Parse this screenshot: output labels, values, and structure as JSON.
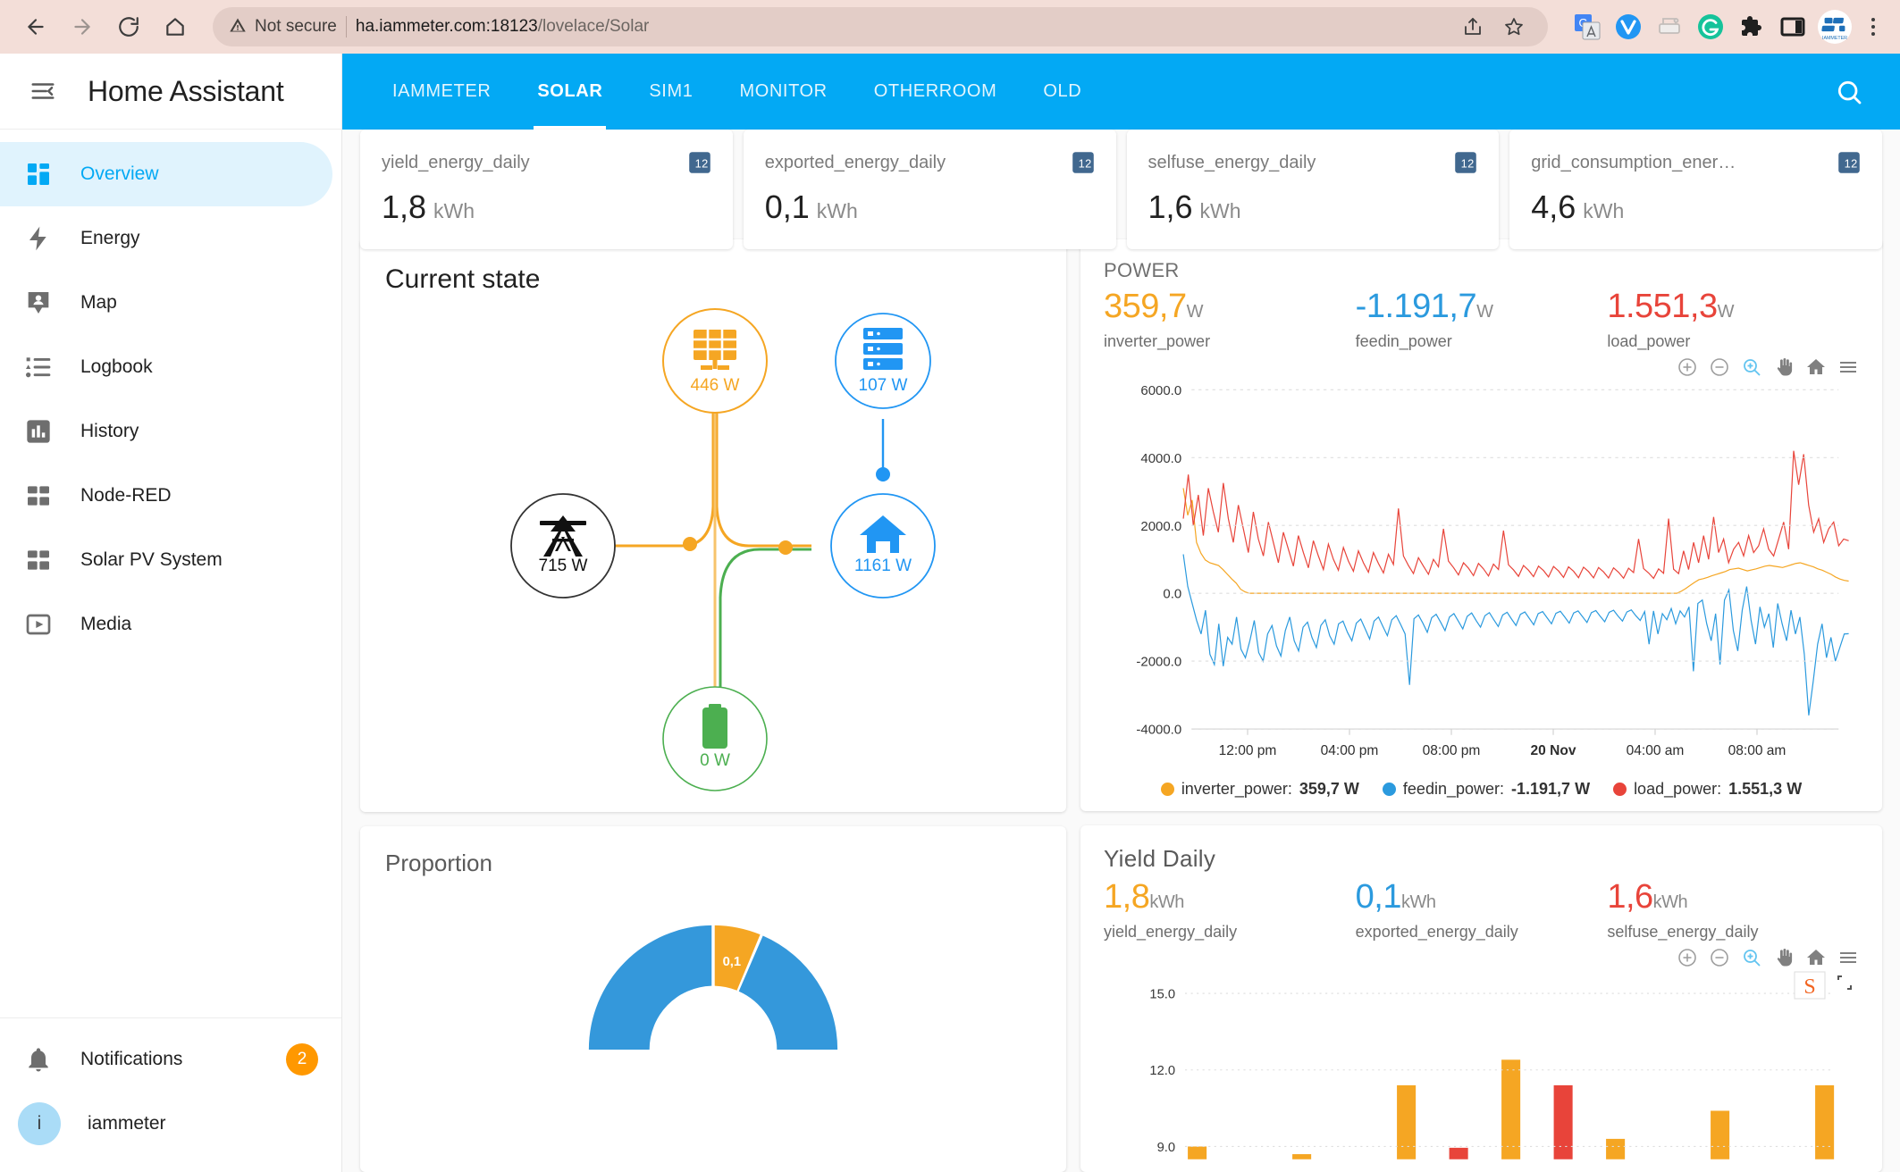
{
  "browser": {
    "security_label": "Not secure",
    "url_host": "ha.iammeter.com:18123",
    "url_path": "/lovelace/Solar",
    "icons": [
      "back-icon",
      "forward-icon",
      "reload-icon",
      "home-icon",
      "warning-icon",
      "share-icon",
      "bookmark-star-icon",
      "google-translate-icon",
      "vimium-icon",
      "print-icon",
      "grammarly-icon",
      "extensions-puzzle-icon",
      "side-panel-icon",
      "profile-avatar-icon",
      "browser-menu-icon"
    ]
  },
  "sidebar": {
    "title": "Home Assistant",
    "items": [
      {
        "label": "Overview",
        "icon": "view-dashboard-icon",
        "active": true
      },
      {
        "label": "Energy",
        "icon": "lightning-bolt-icon",
        "active": false
      },
      {
        "label": "Map",
        "icon": "map-marker-account-icon",
        "active": false
      },
      {
        "label": "Logbook",
        "icon": "format-list-icon",
        "active": false
      },
      {
        "label": "History",
        "icon": "chart-box-icon",
        "active": false
      },
      {
        "label": "Node-RED",
        "icon": "view-dashboard-icon",
        "active": false
      },
      {
        "label": "Solar PV System",
        "icon": "view-dashboard-icon",
        "active": false
      },
      {
        "label": "Media",
        "icon": "play-box-icon",
        "active": false
      }
    ],
    "notifications": {
      "label": "Notifications",
      "count": "2",
      "icon": "bell-icon"
    },
    "user": {
      "label": "iammeter",
      "initial": "i"
    }
  },
  "topbar": {
    "tabs": [
      {
        "label": "IAMMETER",
        "active": false
      },
      {
        "label": "SOLAR",
        "active": true
      },
      {
        "label": "SIM1",
        "active": false
      },
      {
        "label": "MONITOR",
        "active": false
      },
      {
        "label": "OTHERROOM",
        "active": false
      },
      {
        "label": "OLD",
        "active": false
      }
    ],
    "search_icon": "search-icon"
  },
  "stat_cards": [
    {
      "name": "yield_energy_daily",
      "value": "1,8",
      "unit": "kWh",
      "icon": "numeric-badge-icon"
    },
    {
      "name": "exported_energy_daily",
      "value": "0,1",
      "unit": "kWh",
      "icon": "numeric-badge-icon"
    },
    {
      "name": "selfuse_energy_daily",
      "value": "1,6",
      "unit": "kWh",
      "icon": "numeric-badge-icon"
    },
    {
      "name": "grid_consumption_ener…",
      "value": "4,6",
      "unit": "kWh",
      "icon": "numeric-badge-icon"
    }
  ],
  "current_state": {
    "title": "Current state",
    "nodes": {
      "solar": {
        "value": "446 W",
        "icon": "solar-panel-icon",
        "color": "#f5a623"
      },
      "grid": {
        "value": "715 W",
        "icon": "transmission-tower-icon",
        "color": "#212121"
      },
      "home": {
        "value": "1161 W",
        "icon": "home-icon",
        "color": "#2196f3"
      },
      "server": {
        "value": "107 W",
        "icon": "server-rack-icon",
        "color": "#2196f3"
      },
      "battery": {
        "value": "0 W",
        "icon": "battery-icon",
        "color": "#4caf50"
      }
    }
  },
  "proportion": {
    "title": "Proportion",
    "slice_label": "0,1"
  },
  "power_card": {
    "title": "POWER",
    "stats": [
      {
        "value": "359,7",
        "unit": "W",
        "name": "inverter_power",
        "color": "#f5a623"
      },
      {
        "value": "-1.191,7",
        "unit": "W",
        "name": "feedin_power",
        "color": "#2b9ade"
      },
      {
        "value": "1.551,3",
        "unit": "W",
        "name": "load_power",
        "color": "#e8443a"
      }
    ],
    "tools": [
      "zoom-in-icon",
      "zoom-out-icon",
      "selection-zoom-icon",
      "pan-hand-icon",
      "reset-home-icon",
      "menu-icon"
    ],
    "legend": [
      {
        "label": "inverter_power:",
        "value": "359,7 W",
        "color": "#f5a623"
      },
      {
        "label": "feedin_power:",
        "value": "-1.191,7 W",
        "color": "#2b9ade"
      },
      {
        "label": "load_power:",
        "value": "1.551,3 W",
        "color": "#e8443a"
      }
    ]
  },
  "yield_card": {
    "title": "Yield Daily",
    "stats": [
      {
        "value": "1,8",
        "unit": "kWh",
        "name": "yield_energy_daily",
        "color": "#f5a623"
      },
      {
        "value": "0,1",
        "unit": "kWh",
        "name": "exported_energy_daily",
        "color": "#2b9ade"
      },
      {
        "value": "1,6",
        "unit": "kWh",
        "name": "selfuse_energy_daily",
        "color": "#e8443a"
      }
    ],
    "tools": [
      "zoom-in-icon",
      "zoom-out-icon",
      "selection-zoom-icon",
      "pan-hand-icon",
      "reset-home-icon",
      "menu-icon"
    ]
  },
  "chart_data": [
    {
      "type": "line",
      "title": "POWER",
      "xlabel": "",
      "ylabel": "",
      "ylim": [
        -4000,
        6000
      ],
      "yticks": [
        6000.0,
        4000.0,
        2000.0,
        0.0,
        -2000.0,
        -4000.0
      ],
      "ytick_labels": [
        "6000.0",
        "4000.0",
        "2000.0",
        "0.0",
        "-2000.0",
        "-4000.0"
      ],
      "xtick_labels": [
        "12:00 pm",
        "04:00 pm",
        "08:00 pm",
        "20 Nov",
        "04:00 am",
        "08:00 am"
      ],
      "grid": true,
      "legend_position": "bottom",
      "series": [
        {
          "name": "inverter_power",
          "color": "#f5a623",
          "current": 359.7,
          "values": [
            3100,
            2300,
            2750,
            1500,
            1180,
            980,
            900,
            860,
            820,
            700,
            560,
            420,
            300,
            120,
            40,
            0,
            0,
            0,
            0,
            0,
            0,
            0,
            0,
            0,
            0,
            0,
            0,
            0,
            0,
            0,
            0,
            0,
            0,
            0,
            0,
            0,
            0,
            0,
            0,
            0,
            0,
            0,
            0,
            0,
            0,
            0,
            0,
            0,
            0,
            0,
            0,
            0,
            0,
            0,
            0,
            0,
            0,
            0,
            0,
            0,
            0,
            0,
            0,
            0,
            0,
            0,
            0,
            0,
            0,
            0,
            0,
            0,
            0,
            0,
            0,
            0,
            0,
            0,
            0,
            0,
            0,
            0,
            0,
            0,
            0,
            0,
            0,
            0,
            0,
            0,
            0,
            0,
            0,
            0,
            0,
            0,
            0,
            0,
            0,
            0,
            0,
            0,
            0,
            0,
            0,
            0,
            0,
            0,
            0,
            0,
            0,
            0,
            0,
            60,
            140,
            230,
            320,
            400,
            430,
            470,
            520,
            560,
            600,
            640,
            700,
            720,
            740,
            700,
            660,
            690,
            720,
            760,
            800,
            820,
            800,
            780,
            760,
            800,
            840,
            880,
            900,
            860,
            820,
            780,
            720,
            680,
            620,
            560,
            480,
            420,
            380,
            359
          ]
        },
        {
          "name": "feedin_power",
          "color": "#2b9ade",
          "current": -1191.7,
          "values": [
            1150,
            200,
            -300,
            -800,
            -1200,
            -500,
            -1800,
            -2100,
            -900,
            -2150,
            -1300,
            -1500,
            -700,
            -1650,
            -1900,
            -1400,
            -800,
            -1750,
            -2000,
            -1200,
            -950,
            -1550,
            -1850,
            -1100,
            -700,
            -1400,
            -1700,
            -1000,
            -850,
            -1300,
            -1600,
            -950,
            -780,
            -1250,
            -1500,
            -900,
            -820,
            -1150,
            -1400,
            -880,
            -760,
            -1050,
            -1350,
            -820,
            -700,
            -980,
            -1250,
            -780,
            -660,
            -920,
            -1200,
            -2700,
            -750,
            -640,
            -880,
            -1150,
            -720,
            -620,
            -850,
            -1100,
            -700,
            -600,
            -820,
            -1050,
            -680,
            -580,
            -800,
            -1000,
            -660,
            -570,
            -780,
            -980,
            -640,
            -560,
            -760,
            -950,
            -620,
            -550,
            -740,
            -930,
            -600,
            -540,
            -720,
            -900,
            -590,
            -530,
            -700,
            -880,
            -580,
            -520,
            -690,
            -860,
            -570,
            -510,
            -680,
            -840,
            -560,
            -500,
            -670,
            -820,
            -550,
            -490,
            -660,
            -800,
            -540,
            -1500,
            -520,
            -1200,
            -600,
            -780,
            -450,
            -900,
            -520,
            -700,
            -400,
            -2300,
            -300,
            -200,
            -900,
            -1400,
            -600,
            -2100,
            -200,
            100,
            -1100,
            -1700,
            -500,
            200,
            -800,
            -1500,
            -400,
            -1000,
            -600,
            -1600,
            -300,
            -900,
            -1400,
            -500,
            -1200,
            -700,
            -1800,
            -3600,
            -2600,
            -1500,
            -900,
            -1900,
            -1300,
            -2000,
            -1600,
            -1200,
            -1191
          ]
        },
        {
          "name": "load_power",
          "color": "#e8443a",
          "current": 1551.3,
          "values": [
            2200,
            3500,
            2000,
            2900,
            1700,
            3100,
            2400,
            1800,
            3250,
            2200,
            1500,
            2600,
            1900,
            1200,
            2400,
            1600,
            1100,
            2100,
            1500,
            900,
            1800,
            1300,
            800,
            1700,
            1200,
            750,
            1550,
            1100,
            700,
            1450,
            1000,
            680,
            1350,
            950,
            650,
            1250,
            900,
            620,
            1200,
            880,
            600,
            1150,
            850,
            2500,
            1100,
            820,
            580,
            1050,
            800,
            560,
            1000,
            780,
            1900,
            950,
            760,
            540,
            900,
            740,
            520,
            880,
            720,
            510,
            860,
            700,
            1850,
            840,
            690,
            500,
            820,
            680,
            490,
            800,
            670,
            480,
            790,
            660,
            470,
            780,
            650,
            460,
            770,
            640,
            455,
            760,
            630,
            450,
            750,
            620,
            445,
            740,
            610,
            1600,
            730,
            600,
            440,
            720,
            590,
            2200,
            710,
            580,
            1250,
            700,
            1500,
            900,
            1700,
            1000,
            2250,
            1200,
            1600,
            900,
            1300,
            1500,
            1100,
            1700,
            1200,
            1400,
            1900,
            1300,
            1100,
            1600,
            2100,
            1300,
            4200,
            3200,
            4100,
            2600,
            1800,
            2200,
            1500,
            1900,
            2100,
            1400,
            1600,
            1551
          ]
        }
      ]
    },
    {
      "type": "bar",
      "title": "Yield Daily",
      "ylim": [
        8.5,
        15.6
      ],
      "yticks": [
        15.0,
        12.0,
        9.0
      ],
      "ytick_labels": [
        "15.0",
        "12.0",
        "9.0"
      ],
      "grid": true,
      "series": [
        {
          "name": "yield_energy_daily",
          "color": "#f5a623",
          "values": [
            9.0,
            null,
            8.7,
            null,
            11.4,
            null,
            12.4,
            null,
            9.3,
            null,
            10.4,
            null,
            11.4
          ]
        },
        {
          "name": "load_power",
          "color": "#e8443a",
          "values": [
            null,
            null,
            null,
            null,
            null,
            8.95,
            null,
            11.4,
            null,
            null,
            null,
            null,
            null
          ]
        }
      ]
    }
  ]
}
